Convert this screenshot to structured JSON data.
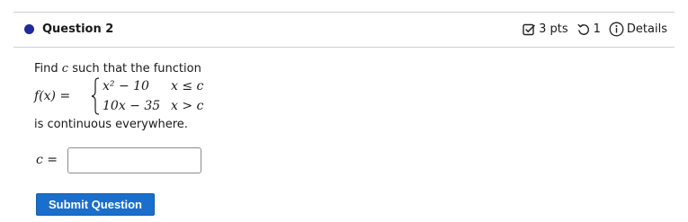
{
  "question": {
    "title": "Question 2",
    "points": "3 pts",
    "attempts": "1",
    "details_label": "Details"
  },
  "body": {
    "prompt_prefix": "Find ",
    "prompt_var": "c",
    "prompt_suffix": " such that the function",
    "pw_lhs": "f(x) =",
    "case1_expr": "x² − 10",
    "case1_cond": "x ≤ c",
    "case2_expr": "10x − 35",
    "case2_cond": "x > c",
    "continuous_text": "is continuous everywhere."
  },
  "answer": {
    "label": "c =",
    "value": "",
    "placeholder": ""
  },
  "submit": {
    "label": "Submit Question"
  },
  "icons": {
    "status_dot": "status-dot-icon",
    "points": "checkbox-icon",
    "attempts": "retry-icon",
    "details": "info-icon"
  },
  "colors": {
    "status_dot": "#1f2a9c",
    "submit_button": "#1a6ecc"
  }
}
